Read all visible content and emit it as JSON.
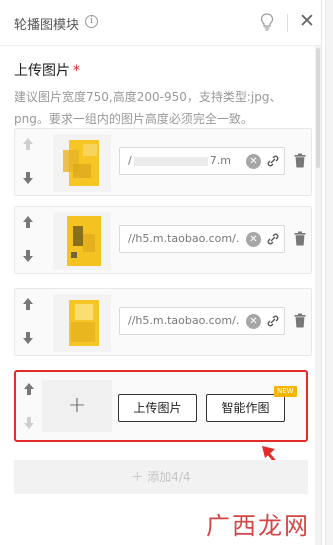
{
  "header": {
    "title": "轮播图模块",
    "info_glyph": "i",
    "close_glyph": "✕"
  },
  "section": {
    "title": "上传图片",
    "required_mark": "*",
    "hint": "建议图片宽度750,高度200-950，支持类型:jpg、png。要求一组内的图片高度必须完全一致。"
  },
  "rows": [
    {
      "url": "/",
      "url_tail": "7.m"
    },
    {
      "url": "//h5.m.taobao.com/."
    },
    {
      "url": "//h5.m.taobao.com/."
    }
  ],
  "add_row": {
    "plus_glyph": "+",
    "upload_label": "上传图片",
    "ai_label": "智能作图",
    "new_badge": "NEW"
  },
  "add_button": {
    "label": "＋ 添加4/4"
  },
  "watermark": "广西龙网",
  "colors": {
    "highlight": "#e52a2a",
    "badge": "#f7b500",
    "thumb_yellow": "#f5c518"
  },
  "icons": {
    "up": "arrow-up-icon",
    "down": "arrow-down-icon",
    "clear": "clear-icon",
    "link": "link-icon",
    "trash": "trash-icon"
  }
}
